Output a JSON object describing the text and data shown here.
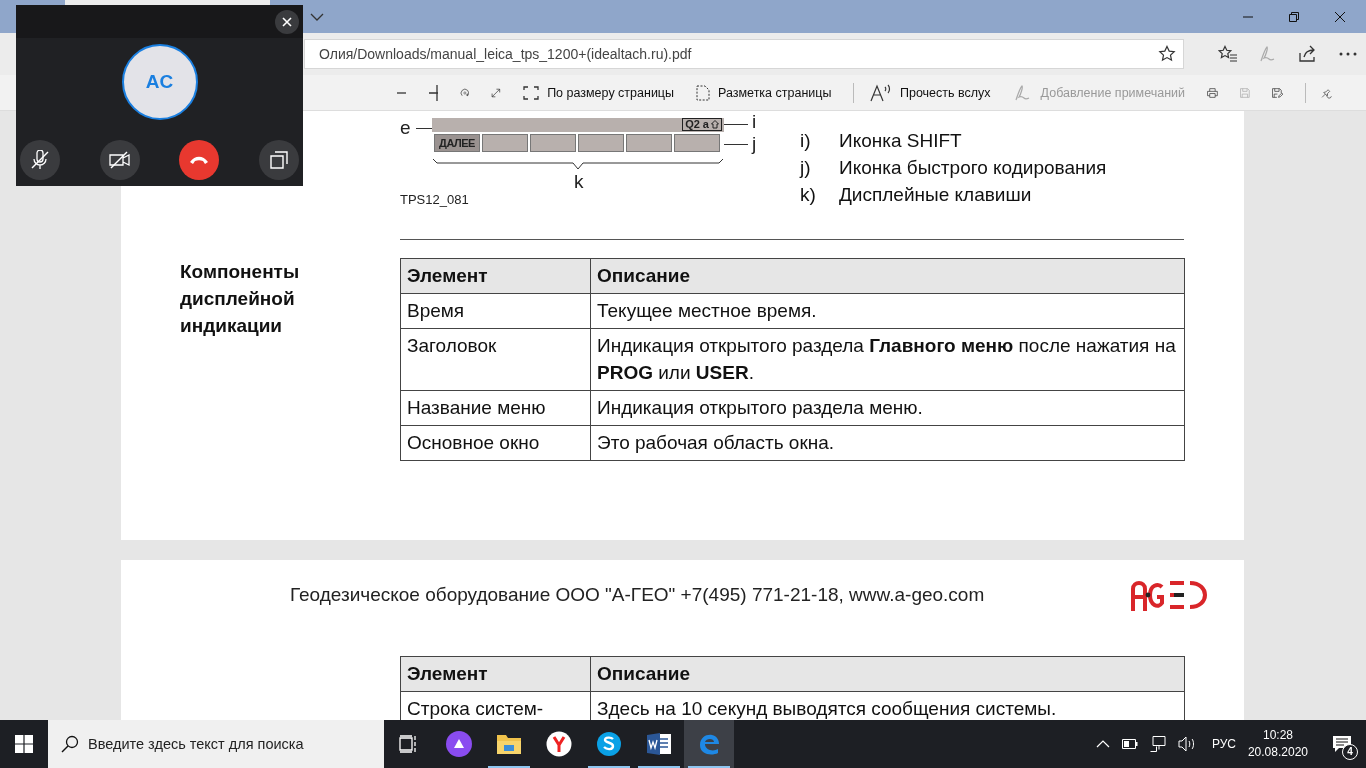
{
  "browser": {
    "address": "Олия/Downloads/manual_leica_tps_1200+(idealtach.ru).pdf",
    "favorite": false,
    "toolbar": {
      "fit_page": "По размеру страницы",
      "page_layout": "Разметка страницы",
      "read_aloud": "Прочесть вслух",
      "annotate": {
        "label": "Добавление примечаний",
        "disabled": true
      },
      "save_disabled": true
    }
  },
  "call": {
    "initials": "AC",
    "muted": true,
    "video_off": true
  },
  "document": {
    "figure": {
      "labels": [
        "e",
        "i",
        "j",
        "k"
      ],
      "softkey": "ДАЛЕЕ",
      "status": "Q2 a",
      "caption": "TPS12_081"
    },
    "legend": [
      {
        "letter": "i)",
        "text": "Иконка SHIFT"
      },
      {
        "letter": "j)",
        "text": "Иконка быстрого кодирования"
      },
      {
        "letter": "k)",
        "text": "Дисплейные клавиши"
      }
    ],
    "section_title": "Компоненты дисплейной индикации",
    "table": {
      "columns": [
        "Элемент",
        "Описание"
      ],
      "rows": [
        [
          "Время",
          "Текущее местное время."
        ],
        [
          "Заголовок",
          "Индикация открытого раздела **Главного меню** после нажатия на **PROG** или **USER**."
        ],
        [
          "Название меню",
          "Индикация открытого раздела меню."
        ],
        [
          "Основное окно",
          "Это рабочая область окна."
        ]
      ]
    },
    "footer": "Геодезическое оборудование ООО \"А-ГЕО\" +7(495) 771-21-18, www.a-geo.com",
    "table_2": {
      "columns": [
        "Элемент",
        "Описание"
      ],
      "rows": [
        [
          "Строка систем-",
          "Здесь на 10 секунд выводятся сообщения системы."
        ]
      ]
    }
  },
  "taskbar": {
    "search_placeholder": "Введите здесь текст для поиска",
    "apps": [
      {
        "running": false,
        "selected": false
      },
      {
        "running": false,
        "selected": false
      },
      {
        "running": true,
        "selected": false
      },
      {
        "running": false,
        "selected": false
      },
      {
        "running": true,
        "selected": false
      },
      {
        "running": true,
        "selected": false
      },
      {
        "running": true,
        "selected": true
      }
    ],
    "language": "РУС",
    "time": "10:28",
    "date": "20.08.2020",
    "notifications": "4"
  }
}
